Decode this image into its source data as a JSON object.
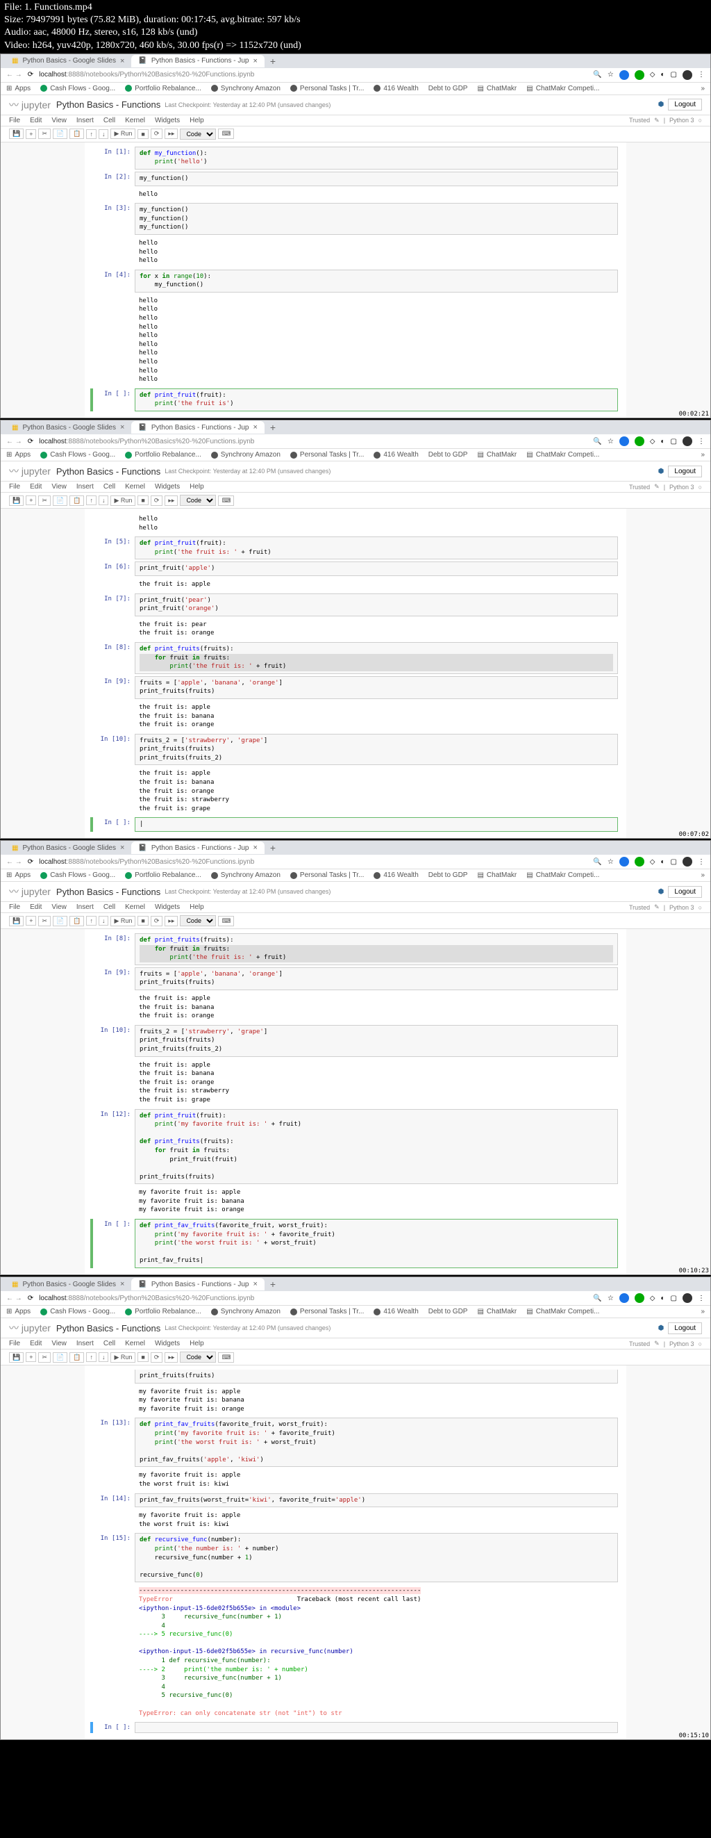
{
  "header": {
    "file": "File: 1. Functions.mp4",
    "size": "Size: 79497991 bytes (75.82 MiB), duration: 00:17:45, avg.bitrate: 597 kb/s",
    "audio": "Audio: aac, 48000 Hz, stereo, s16, 128 kb/s (und)",
    "video": "Video: h264, yuv420p, 1280x720, 460 kb/s, 30.00 fps(r) => 1152x720 (und)"
  },
  "browser": {
    "tab1": "Python Basics - Google Slides",
    "tab2": "Python Basics - Functions - Jup",
    "url_host": "localhost",
    "url_path": ":8888/notebooks/Python%20Basics%20-%20Functions.ipynb",
    "bookmarks": {
      "apps": "Apps",
      "cashflows": "Cash Flows - Goog...",
      "portfolio": "Portfolio Rebalance...",
      "synchrony": "Synchrony Amazon",
      "personal": "Personal Tasks | Tr...",
      "wealth": "416 Wealth",
      "debt": "Debt to GDP",
      "chatmakr": "ChatMakr",
      "chatmakr2": "ChatMakr Competi..."
    }
  },
  "jupyter": {
    "logo_prefix": "jupyter",
    "title": "Python Basics - Functions",
    "checkpoint": "Last Checkpoint: Yesterday at 12:40 PM",
    "unsaved": "(unsaved changes)",
    "logout": "Logout",
    "menus": {
      "file": "File",
      "edit": "Edit",
      "view": "View",
      "insert": "Insert",
      "cell": "Cell",
      "kernel": "Kernel",
      "widgets": "Widgets",
      "help": "Help"
    },
    "trusted": "Trusted",
    "kernel_name": "Python 3",
    "toolbar": {
      "run": "Run",
      "celltype": "Code"
    }
  },
  "panel1": {
    "timestamp": "00:02:21",
    "cells": [
      {
        "prompt": "In [1]:",
        "type": "code",
        "lines": [
          {
            "t": "def",
            "c": "kw"
          },
          {
            "t": " my_function():",
            "plain": true
          },
          {
            "t": "    print(",
            "plain": true
          },
          {
            "t": "'hello'",
            "c": "str"
          },
          {
            "t": ")",
            "plain": true
          }
        ],
        "raw": "def my_function():\n    print('hello')"
      },
      {
        "prompt": "In [2]:",
        "type": "code",
        "raw": "my_function()"
      },
      {
        "prompt": "",
        "type": "output",
        "raw": "hello"
      },
      {
        "prompt": "In [3]:",
        "type": "code",
        "raw": "my_function()\nmy_function()\nmy_function()"
      },
      {
        "prompt": "",
        "type": "output",
        "raw": "hello\nhello\nhello"
      },
      {
        "prompt": "In [4]:",
        "type": "code",
        "raw": "for x in range(10):\n    my_function()"
      },
      {
        "prompt": "",
        "type": "output",
        "raw": "hello\nhello\nhello\nhello\nhello\nhello\nhello\nhello\nhello\nhello"
      },
      {
        "prompt": "In [ ]:",
        "type": "code",
        "active": true,
        "raw": "def print_fruit(fruit):\n    print('the fruit is')"
      }
    ]
  },
  "panel2": {
    "timestamp": "00:07:02",
    "cells": [
      {
        "prompt": "",
        "type": "output",
        "raw": "hello\nhello"
      },
      {
        "prompt": "In [5]:",
        "type": "code",
        "raw": "def print_fruit(fruit):\n    print('the fruit is: ' + fruit)"
      },
      {
        "prompt": "In [6]:",
        "type": "code",
        "raw": "print_fruit('apple')"
      },
      {
        "prompt": "",
        "type": "output",
        "raw": "the fruit is: apple"
      },
      {
        "prompt": "In [7]:",
        "type": "code",
        "raw": "print_fruit('pear')\nprint_fruit('orange')"
      },
      {
        "prompt": "",
        "type": "output",
        "raw": "the fruit is: pear\nthe fruit is: orange"
      },
      {
        "prompt": "In [8]:",
        "type": "code",
        "raw": "def print_fruits(fruits):\n    for fruit in fruits:\n        print('the fruit is: ' + fruit)",
        "hl": true
      },
      {
        "prompt": "In [9]:",
        "type": "code",
        "raw": "fruits = ['apple', 'banana', 'orange']\nprint_fruits(fruits)"
      },
      {
        "prompt": "",
        "type": "output",
        "raw": "the fruit is: apple\nthe fruit is: banana\nthe fruit is: orange"
      },
      {
        "prompt": "In [10]:",
        "type": "code",
        "raw": "fruits_2 = ['strawberry', 'grape']\nprint_fruits(fruits)\nprint_fruits(fruits_2)"
      },
      {
        "prompt": "",
        "type": "output",
        "raw": "the fruit is: apple\nthe fruit is: banana\nthe fruit is: orange\nthe fruit is: strawberry\nthe fruit is: grape"
      },
      {
        "prompt": "In [ ]:",
        "type": "code",
        "active": true,
        "raw": ""
      }
    ]
  },
  "panel3": {
    "timestamp": "00:10:23",
    "cells": [
      {
        "prompt": "In [8]:",
        "type": "code",
        "raw": "def print_fruits(fruits):\n    for fruit in fruits:\n        print('the fruit is: ' + fruit)",
        "hl": true
      },
      {
        "prompt": "In [9]:",
        "type": "code",
        "raw": "fruits = ['apple', 'banana', 'orange']\nprint_fruits(fruits)"
      },
      {
        "prompt": "",
        "type": "output",
        "raw": "the fruit is: apple\nthe fruit is: banana\nthe fruit is: orange"
      },
      {
        "prompt": "In [10]:",
        "type": "code",
        "raw": "fruits_2 = ['strawberry', 'grape']\nprint_fruits(fruits)\nprint_fruits(fruits_2)"
      },
      {
        "prompt": "",
        "type": "output",
        "raw": "the fruit is: apple\nthe fruit is: banana\nthe fruit is: orange\nthe fruit is: strawberry\nthe fruit is: grape"
      },
      {
        "prompt": "In [12]:",
        "type": "code",
        "raw": "def print_fruit(fruit):\n    print('my favorite fruit is: ' + fruit)\n\ndef print_fruits(fruits):\n    for fruit in fruits:\n        print_fruit(fruit)\n\nprint_fruits(fruits)"
      },
      {
        "prompt": "",
        "type": "output",
        "raw": "my favorite fruit is: apple\nmy favorite fruit is: banana\nmy favorite fruit is: orange"
      },
      {
        "prompt": "In [ ]:",
        "type": "code",
        "active": true,
        "raw": "def print_fav_fruits(favorite_fruit, worst_fruit):\n    print('my favorite fruit is: ' + favorite_fruit)\n    print('the worst fruit is: ' + worst_fruit)\n\nprint_fav_fruits"
      }
    ]
  },
  "panel4": {
    "timestamp": "00:15:10",
    "cells": [
      {
        "prompt": "",
        "code_frag": "print_fruits(fruits)"
      },
      {
        "prompt": "",
        "type": "output",
        "raw": "my favorite fruit is: apple\nmy favorite fruit is: banana\nmy favorite fruit is: orange"
      },
      {
        "prompt": "In [13]:",
        "type": "code",
        "raw": "def print_fav_fruits(favorite_fruit, worst_fruit):\n    print('my favorite fruit is: ' + favorite_fruit)\n    print('the worst fruit is: ' + worst_fruit)\n\nprint_fav_fruits('apple', 'kiwi')"
      },
      {
        "prompt": "",
        "type": "output",
        "raw": "my favorite fruit is: apple\nthe worst fruit is: kiwi"
      },
      {
        "prompt": "In [14]:",
        "type": "code",
        "raw": "print_fav_fruits(worst_fruit='kiwi', favorite_fruit='apple')"
      },
      {
        "prompt": "",
        "type": "output",
        "raw": "my favorite fruit is: apple\nthe worst fruit is: kiwi"
      },
      {
        "prompt": "In [15]:",
        "type": "code",
        "raw": "def recursive_func(number):\n    print('the number is: ' + number)\n    recursive_func(number + 1)\n\nrecursive_func(0)"
      },
      {
        "prompt": "",
        "type": "output-err",
        "raw_html": true
      },
      {
        "prompt": "In [ ]:",
        "type": "code",
        "active": true,
        "raw": ""
      }
    ],
    "error": {
      "typeerror": "TypeError",
      "traceback": "Traceback (most recent call last)",
      "loc1": "<ipython-input-15-6de02f5b655e> in <module>",
      "l1": "      3     recursive_func(number + 1)",
      "l2": "      4 ",
      "l3": "----> 5 recursive_func(0)",
      "loc2": "<ipython-input-15-6de02f5b655e> in recursive_func(number)",
      "l4": "      1 def recursive_func(number):",
      "l5": "----> 2     print('the number is: ' + number)",
      "l6": "      3     recursive_func(number + 1)",
      "l7": "      4 ",
      "l8": "      5 recursive_func(0)",
      "msg": "TypeError: can only concatenate str (not \"int\") to str"
    }
  }
}
